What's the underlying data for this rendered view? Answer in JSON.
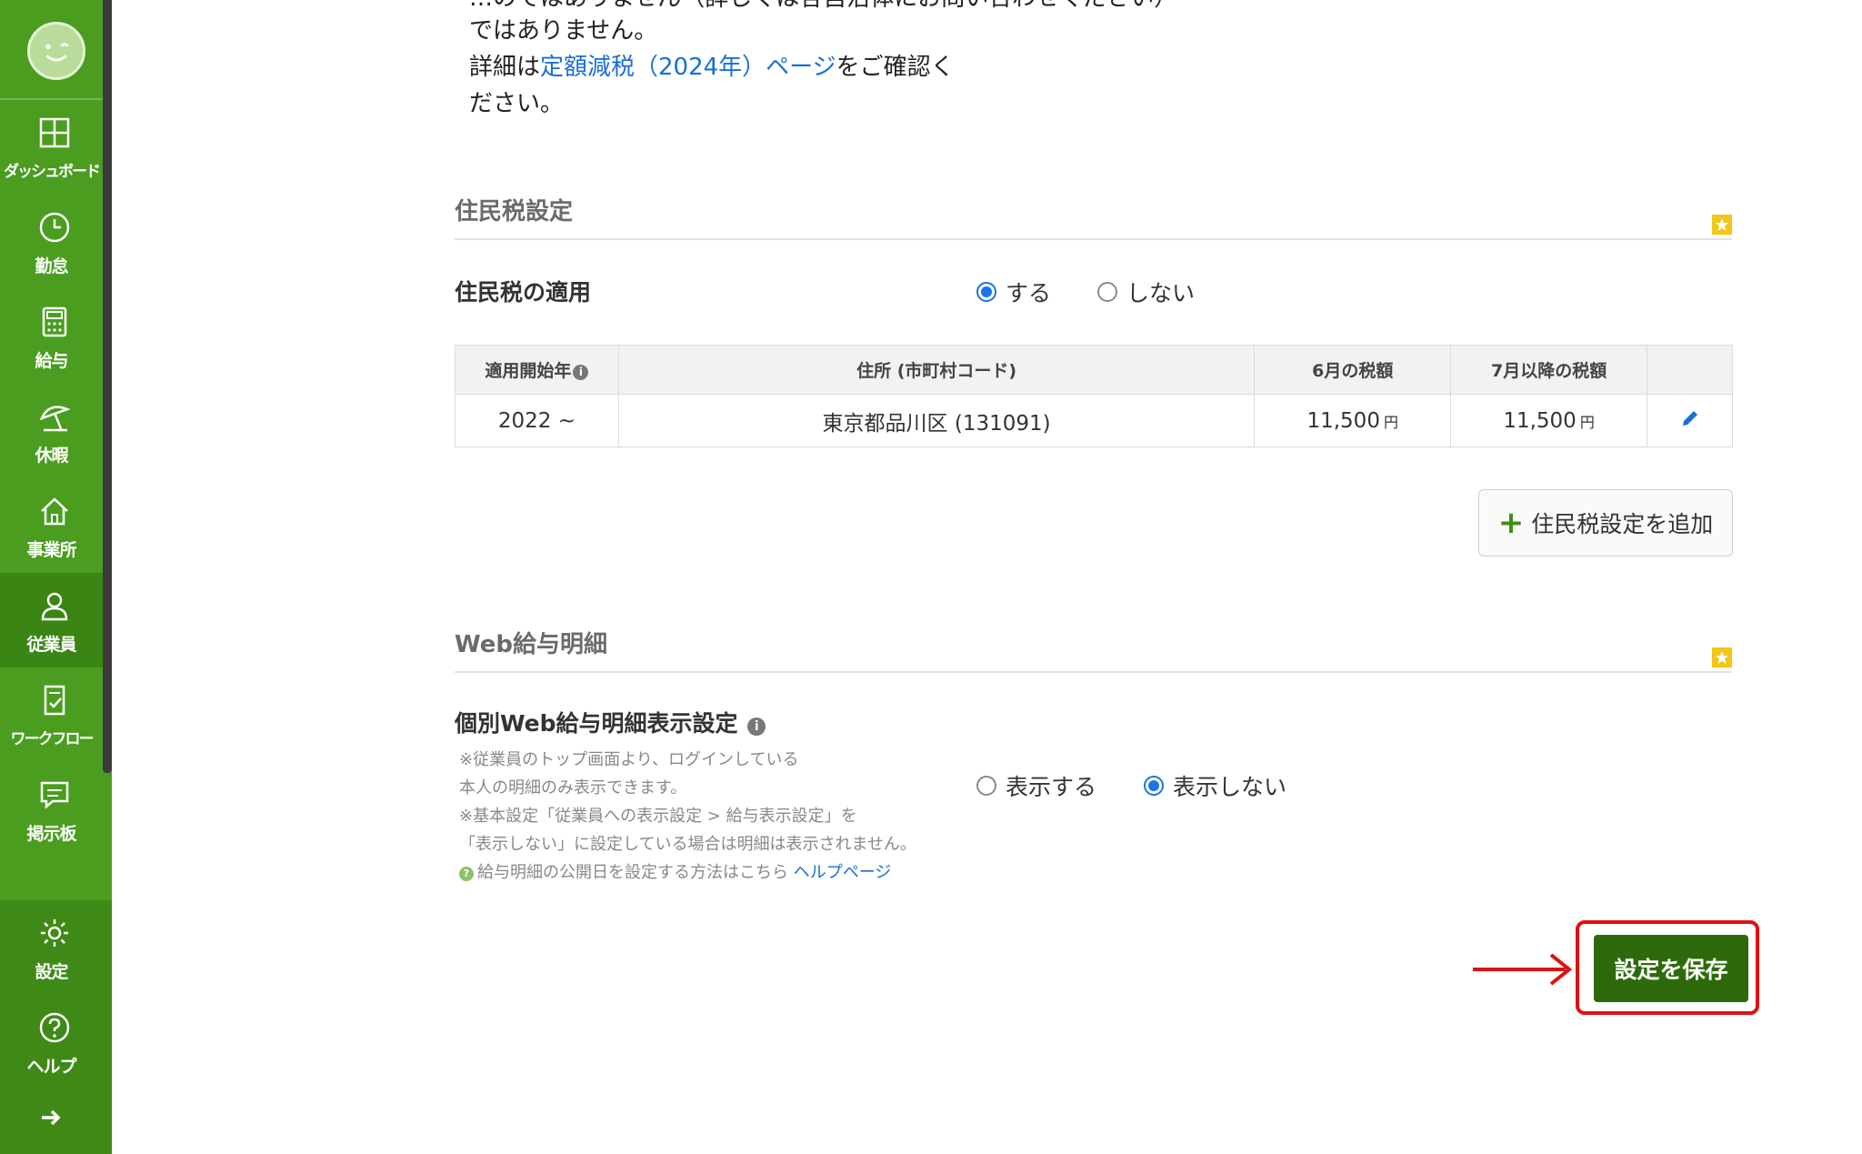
{
  "sidebar": {
    "items": [
      {
        "label": "ダッシュボード",
        "icon": "dashboard-icon"
      },
      {
        "label": "勤怠",
        "icon": "clock-icon"
      },
      {
        "label": "給与",
        "icon": "calculator-icon"
      },
      {
        "label": "休暇",
        "icon": "beach-umbrella-icon"
      },
      {
        "label": "事業所",
        "icon": "home-icon"
      },
      {
        "label": "従業員",
        "icon": "person-icon"
      },
      {
        "label": "ワークフロー",
        "icon": "checklist-icon"
      },
      {
        "label": "掲示板",
        "icon": "message-board-icon"
      },
      {
        "label": "設定",
        "icon": "gear-icon"
      },
      {
        "label": "ヘルプ",
        "icon": "question-icon"
      }
    ],
    "active_item": "従業員",
    "expand_icon": "arrow-right-icon"
  },
  "intro": {
    "line0": "…のではありません（詳しくは各自治体にお問い合わせください）",
    "line1": "ではありません。",
    "line2_prefix": "詳細は",
    "line2_link": "定額減税（2024年）ページ",
    "line2_suffix": "をご確認く",
    "line3": "ださい。"
  },
  "resident_tax": {
    "section_title": "住民税設定",
    "apply_label": "住民税の適用",
    "options": [
      "する",
      "しない"
    ],
    "selected": "する",
    "table": {
      "headers": [
        "適用開始年",
        "住所 (市町村コード)",
        "6月の税額",
        "7月以降の税額"
      ],
      "rows": [
        {
          "start_year": "2022 ~",
          "address": "東京都品川区 (131091)",
          "june": "11,500",
          "july_after": "11,500",
          "unit": "円"
        }
      ]
    },
    "add_button": "住民税設定を追加"
  },
  "web_payslip": {
    "section_title": "Web給与明細",
    "setting_label": "個別Web給与明細表示設定",
    "notes": [
      "※従業員のトップ画面より、ログインしている",
      "本人の明細のみ表示できます。",
      "※基本設定「従業員への表示設定 > 給与表示設定」を",
      "「表示しない」に設定している場合は明細は表示されません。"
    ],
    "help_text": "給与明細の公開日を設定する方法はこちら",
    "help_link": "ヘルプページ",
    "options": [
      "表示する",
      "表示しない"
    ],
    "selected": "表示しない"
  },
  "save_button": "設定を保存",
  "colors": {
    "sidebar": "#4a9d1f",
    "save_button": "#2e6a0c",
    "highlight": "#e01010",
    "link": "#1a6ed8",
    "radio_selected": "#1a73e8",
    "bookmark": "#f5c518"
  }
}
